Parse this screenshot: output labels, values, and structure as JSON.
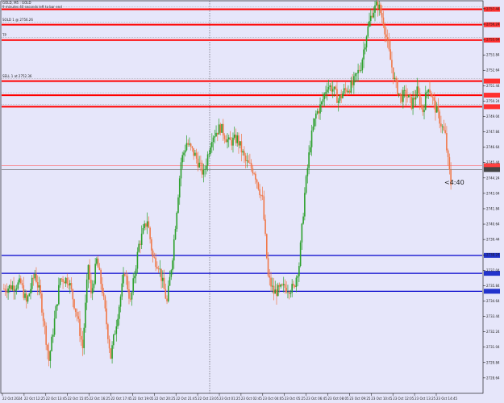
{
  "header": {
    "symbol_line": "GOLD, M5 : GOLD",
    "timer_line": "9 minutes 40 seconds left to bar end"
  },
  "countdown": "<4:40",
  "levels_red": [
    {
      "price": 2757.4,
      "label": ""
    },
    {
      "price": 2756.2,
      "label": "SOLD 1 @ 2756.26"
    },
    {
      "price": 2755.0,
      "label": "TP"
    },
    {
      "price": 2751.8,
      "label": "SELL 1 at 2752.36"
    },
    {
      "price": 2750.7,
      "label": ""
    },
    {
      "price": 2749.8,
      "label": ""
    }
  ],
  "levels_blue": [
    {
      "price": 2738.2
    },
    {
      "price": 2736.8
    },
    {
      "price": 2735.4
    }
  ],
  "current_price": 2744.9,
  "ask_price": 2745.2,
  "colors": {
    "background": "#e6e6fa",
    "bull": "#2ca02c",
    "bear": "#f07848",
    "red_level": "#ff0000",
    "blue_level": "#0000cc",
    "tag_red": "#ff3030",
    "tag_blue": "#2233cc"
  },
  "chart_data": {
    "type": "candlestick",
    "ylim": [
      2727.5,
      2758.0
    ],
    "y_ticks": [
      2757.44,
      2756.24,
      2755.04,
      2753.84,
      2752.64,
      2751.44,
      2750.24,
      2749.04,
      2747.84,
      2746.64,
      2745.44,
      2744.24,
      2743.04,
      2741.84,
      2740.64,
      2739.44,
      2738.24,
      2737.04,
      2735.84,
      2734.64,
      2733.44,
      2732.24,
      2731.04,
      2729.84,
      2728.64
    ],
    "x_ticks": [
      "22 Oct 2024",
      "22 Oct 12:25",
      "22 Oct 13:45",
      "22 Oct 15:05",
      "22 Oct 16:25",
      "22 Oct 17:45",
      "22 Oct 19:05",
      "22 Oct 20:25",
      "22 Oct 21:45",
      "22 Oct 23:05",
      "23 Oct 01:25",
      "23 Oct 02:45",
      "23 Oct 04:05",
      "23 Oct 05:25",
      "23 Oct 06:45",
      "23 Oct 08:05",
      "23 Oct 09:25",
      "23 Oct 10:45",
      "23 Oct 12:05",
      "23 Oct 13:25",
      "23 Oct 14:45"
    ],
    "anchors": [
      [
        0,
        2735.6
      ],
      [
        12,
        2736.0
      ],
      [
        16,
        2734.5
      ],
      [
        22,
        2736.8
      ],
      [
        26,
        2735.0
      ],
      [
        32,
        2730.0
      ],
      [
        34,
        2731.5
      ],
      [
        40,
        2736.4
      ],
      [
        46,
        2736.3
      ],
      [
        52,
        2733.5
      ],
      [
        56,
        2731.0
      ],
      [
        60,
        2737.5
      ],
      [
        62,
        2735.0
      ],
      [
        66,
        2737.8
      ],
      [
        70,
        2735.5
      ],
      [
        76,
        2730.3
      ],
      [
        80,
        2733.0
      ],
      [
        86,
        2737.0
      ],
      [
        90,
        2734.5
      ],
      [
        96,
        2739.0
      ],
      [
        102,
        2741.0
      ],
      [
        106,
        2738.0
      ],
      [
        110,
        2737.5
      ],
      [
        116,
        2734.5
      ],
      [
        120,
        2738.2
      ],
      [
        126,
        2745.5
      ],
      [
        130,
        2747.0
      ],
      [
        136,
        2746.0
      ],
      [
        142,
        2744.5
      ],
      [
        148,
        2747.5
      ],
      [
        154,
        2748.2
      ],
      [
        160,
        2747.0
      ],
      [
        166,
        2747.3
      ],
      [
        172,
        2745.5
      ],
      [
        178,
        2744.8
      ],
      [
        184,
        2742.5
      ],
      [
        188,
        2736.5
      ],
      [
        192,
        2735.3
      ],
      [
        200,
        2735.7
      ],
      [
        206,
        2735.6
      ],
      [
        210,
        2737.5
      ],
      [
        214,
        2743.0
      ],
      [
        218,
        2747.0
      ],
      [
        222,
        2749.2
      ],
      [
        226,
        2750.0
      ],
      [
        230,
        2751.5
      ],
      [
        234,
        2751.2
      ],
      [
        238,
        2750.3
      ],
      [
        242,
        2751.0
      ],
      [
        248,
        2751.5
      ],
      [
        254,
        2753.0
      ],
      [
        258,
        2755.5
      ],
      [
        262,
        2757.2
      ],
      [
        266,
        2757.8
      ],
      [
        270,
        2756.5
      ],
      [
        274,
        2754.0
      ],
      [
        278,
        2751.8
      ],
      [
        282,
        2750.5
      ],
      [
        286,
        2750.8
      ],
      [
        290,
        2750.0
      ],
      [
        294,
        2751.0
      ],
      [
        298,
        2749.5
      ],
      [
        302,
        2751.5
      ],
      [
        306,
        2750.0
      ],
      [
        310,
        2748.8
      ],
      [
        314,
        2747.5
      ],
      [
        316,
        2745.5
      ],
      [
        318,
        2743.8
      ]
    ]
  }
}
